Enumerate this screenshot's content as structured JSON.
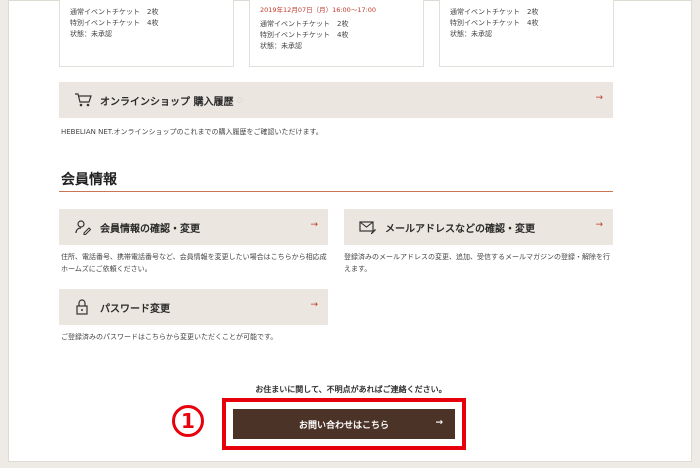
{
  "ticket_cards": [
    {
      "date": "",
      "line1": "通常イベントチケット　2枚",
      "line2": "特別イベントチケット　4枚",
      "status": "状態：未承認"
    },
    {
      "date": "2019年12月07日（月）16:00〜17:00",
      "line1": "通常イベントチケット　2枚",
      "line2": "特別イベントチケット　4枚",
      "status": "状態：未承認"
    },
    {
      "date": "",
      "line1": "通常イベントチケット　2枚",
      "line2": "特別イベントチケット　4枚",
      "status": "状態：未承認"
    }
  ],
  "online_shop": {
    "label": "オンラインショップ 購入履歴",
    "arrow": "→",
    "desc": "HEBELIAN NET.オンラインショップのこれまでの購入履歴をご確認いただけます。"
  },
  "member_section": {
    "title": "会員情報"
  },
  "member_info": {
    "label": "会員情報の確認・変更",
    "arrow": "→",
    "desc": "住所、電話番号、携帯電話番号など、会員情報を変更したい場合はこちらから相応成ホームズにご依頼ください。"
  },
  "email": {
    "label": "メールアドレスなどの確認・変更",
    "arrow": "→",
    "desc": "登録済みのメールアドレスの変更、追加、受信するメールマガジンの登録・解除を行えます。"
  },
  "password": {
    "label": "パスワード変更",
    "arrow": "→",
    "desc": "ご登録済みのパスワードはこちらから変更いただくことが可能です。"
  },
  "contact": {
    "note": "お住まいに関して、不明点があればご連絡ください。",
    "button_label": "お問い合わせはこちら",
    "button_arrow": "→",
    "annotation": "1"
  },
  "colors": {
    "accent": "#e8000a",
    "cta_bg": "#4b3327",
    "banner_bg": "#ebe6df",
    "rule": "#c97654"
  }
}
